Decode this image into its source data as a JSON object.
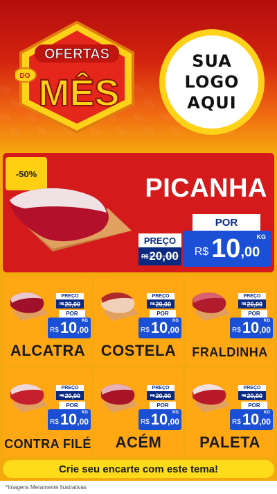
{
  "header": {
    "badge_top": "OFERTAS",
    "badge_do": "DO",
    "badge_main": "MÊS",
    "logo_line1": "SUA",
    "logo_line2": "LOGO",
    "logo_line3": "AQUI"
  },
  "featured": {
    "discount": "-50%",
    "name": "PICANHA",
    "old_label": "PREÇO",
    "old_currency": "R$",
    "old_value": "20,00",
    "new_label": "POR",
    "currency": "R$",
    "price_int": "10",
    "price_cents": ",00",
    "unit": "KG"
  },
  "products": [
    {
      "name": "ALCATRA",
      "old_label": "PREÇO",
      "old_currency": "R$",
      "old_value": "20,00",
      "new_label": "POR",
      "currency": "R$",
      "price_int": "10",
      "price_cents": ",00",
      "unit": "KG"
    },
    {
      "name": "COSTELA",
      "old_label": "PREÇO",
      "old_currency": "R$",
      "old_value": "20,00",
      "new_label": "POR",
      "currency": "R$",
      "price_int": "10",
      "price_cents": ",00",
      "unit": "KG"
    },
    {
      "name": "FRALDINHA",
      "old_label": "PREÇO",
      "old_currency": "R$",
      "old_value": "20,00",
      "new_label": "POR",
      "currency": "R$",
      "price_int": "10",
      "price_cents": ",00",
      "unit": "KG"
    },
    {
      "name": "CONTRA FILÉ",
      "old_label": "PREÇO",
      "old_currency": "R$",
      "old_value": "20,00",
      "new_label": "POR",
      "currency": "R$",
      "price_int": "10",
      "price_cents": ",00",
      "unit": "KG"
    },
    {
      "name": "ACÉM",
      "old_label": "PREÇO",
      "old_currency": "R$",
      "old_value": "20,00",
      "new_label": "POR",
      "currency": "R$",
      "price_int": "10",
      "price_cents": ",00",
      "unit": "KG"
    },
    {
      "name": "PALETA",
      "old_label": "PREÇO",
      "old_currency": "R$",
      "old_value": "20,00",
      "new_label": "POR",
      "currency": "R$",
      "price_int": "10",
      "price_cents": ",00",
      "unit": "KG"
    }
  ],
  "footer": {
    "cta": "Crie seu encarte com este tema!",
    "disclaimer": "*Imagens Meramente Ilustrativas"
  },
  "colors": {
    "header_red": "#b30d0d",
    "featured_red": "#d51a1c",
    "card_orange": "#ffa814",
    "price_blue": "#1a4fd6",
    "old_price_navy": "#0a2a82",
    "cta_yellow": "#ffdb19"
  }
}
